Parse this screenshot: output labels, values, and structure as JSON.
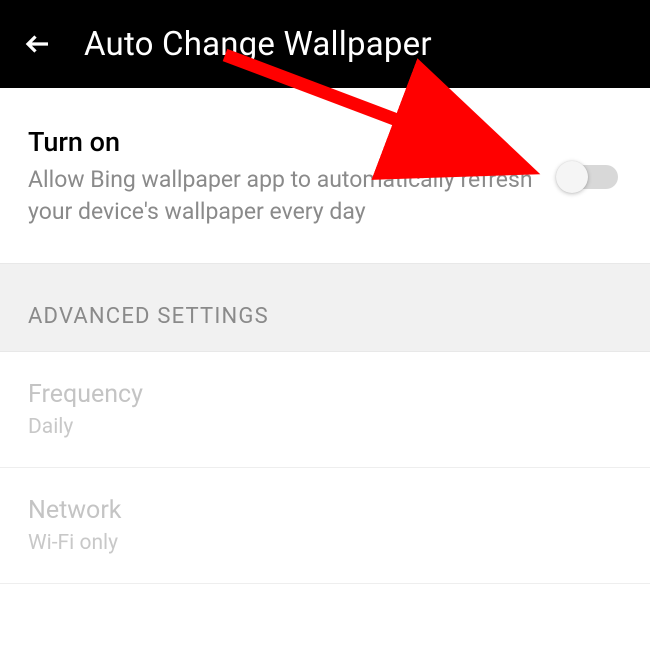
{
  "header": {
    "title": "Auto Change Wallpaper"
  },
  "primary": {
    "label": "Turn on",
    "description": "Allow Bing wallpaper app to automatically refresh your device's wallpaper every day",
    "enabled": false
  },
  "section": {
    "header": "ADVANCED SETTINGS",
    "items": [
      {
        "label": "Frequency",
        "value": "Daily"
      },
      {
        "label": "Network",
        "value": "Wi-Fi only"
      }
    ]
  },
  "annotation": {
    "arrow_color": "#ff0000"
  }
}
